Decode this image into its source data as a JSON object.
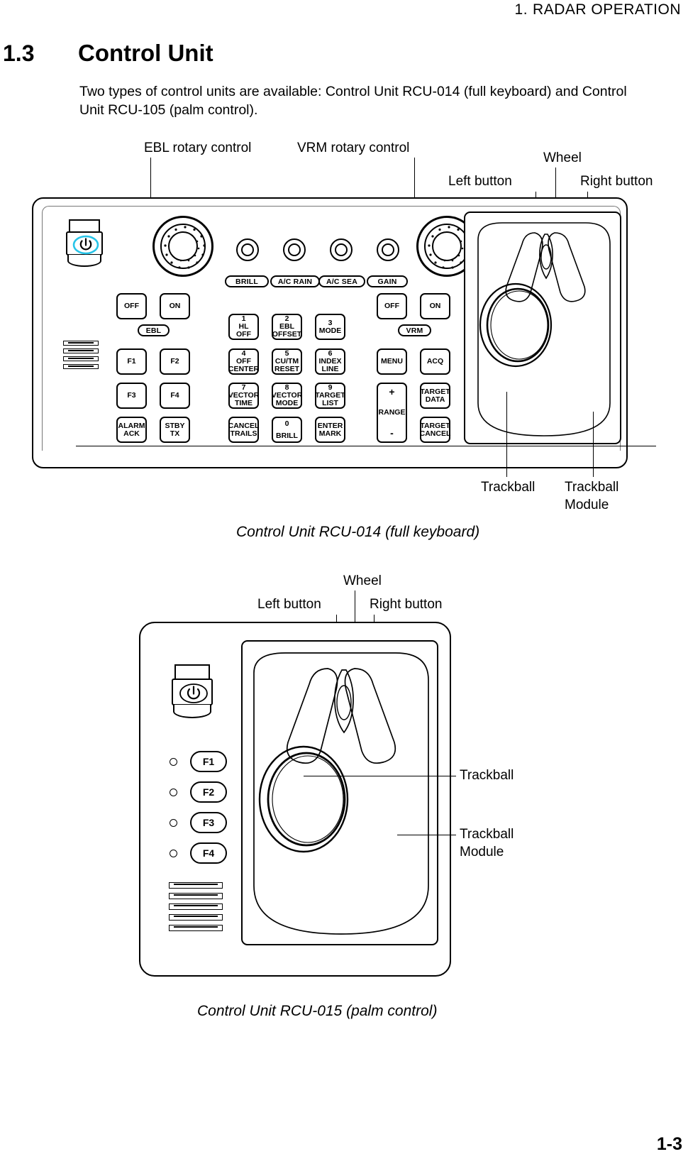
{
  "running_head": {
    "number": "1.",
    "title": "RADAR  OPERATION"
  },
  "section": {
    "number": "1.3",
    "title": "Control Unit"
  },
  "intro": "Two types of control units are available: Control Unit RCU-014 (full keyboard) and Control Unit RCU-105 (palm control).",
  "page_number": "1-3",
  "figure1": {
    "caption": "Control Unit RCU-014 (full keyboard)",
    "callouts": {
      "ebl_rotary": "EBL rotary control",
      "vrm_rotary": "VRM rotary control",
      "wheel": "Wheel",
      "left_button": "Left button",
      "right_button": "Right button",
      "trackball": "Trackball",
      "trackball_module_line1": "Trackball",
      "trackball_module_line2": "Module"
    },
    "power_icon": "power-icon",
    "power_led_color": "#27c4e8",
    "knob_labels": [
      "BRILL",
      "A/C RAIN",
      "A/C SEA",
      "GAIN"
    ],
    "ebl_group": {
      "off": "OFF",
      "on": "ON",
      "pill": "EBL"
    },
    "vrm_group": {
      "off": "OFF",
      "on": "ON",
      "pill": "VRM"
    },
    "function_keys": [
      "F1",
      "F2",
      "F3",
      "F4"
    ],
    "left_keys": [
      {
        "label": "ALARM\nACK",
        "line1": "ALARM",
        "line2": "ACK"
      },
      {
        "label": "STBY\nTX",
        "line1": "STBY",
        "line2": "TX"
      }
    ],
    "numeric_keys": [
      {
        "num": "1",
        "line1": "HL",
        "line2": "OFF"
      },
      {
        "num": "2",
        "line1": "EBL",
        "line2": "OFFSET"
      },
      {
        "num": "3",
        "line1": "MODE",
        "line2": ""
      },
      {
        "num": "4",
        "line1": "OFF",
        "line2": "CENTER"
      },
      {
        "num": "5",
        "line1": "CU/TM",
        "line2": "RESET"
      },
      {
        "num": "6",
        "line1": "INDEX",
        "line2": "LINE"
      },
      {
        "num": "7",
        "line1": "VECTOR",
        "line2": "TIME"
      },
      {
        "num": "8",
        "line1": "VECTOR",
        "line2": "MODE"
      },
      {
        "num": "9",
        "line1": "TARGET",
        "line2": "LIST"
      },
      {
        "num": "",
        "line1": "CANCEL",
        "line2": "TRAILS"
      },
      {
        "num": "0",
        "line1": "BRILL",
        "line2": ""
      },
      {
        "num": "",
        "line1": "ENTER",
        "line2": "MARK"
      }
    ],
    "right_keys": [
      {
        "line1": "MENU",
        "line2": ""
      },
      {
        "line1": "ACQ",
        "line2": ""
      },
      {
        "line1": "TARGET",
        "line2": "DATA"
      },
      {
        "line1": "TARGET",
        "line2": "CANCEL"
      }
    ],
    "range_key": {
      "plus": "+",
      "label": "RANGE",
      "minus": "-"
    }
  },
  "figure2": {
    "caption": "Control Unit RCU-015 (palm control)",
    "callouts": {
      "wheel": "Wheel",
      "left_button": "Left button",
      "right_button": "Right button",
      "trackball": "Trackball",
      "trackball_module_line1": "Trackball",
      "trackball_module_line2": "Module"
    },
    "power_icon": "power-icon",
    "function_keys": [
      "F1",
      "F2",
      "F3",
      "F4"
    ]
  }
}
